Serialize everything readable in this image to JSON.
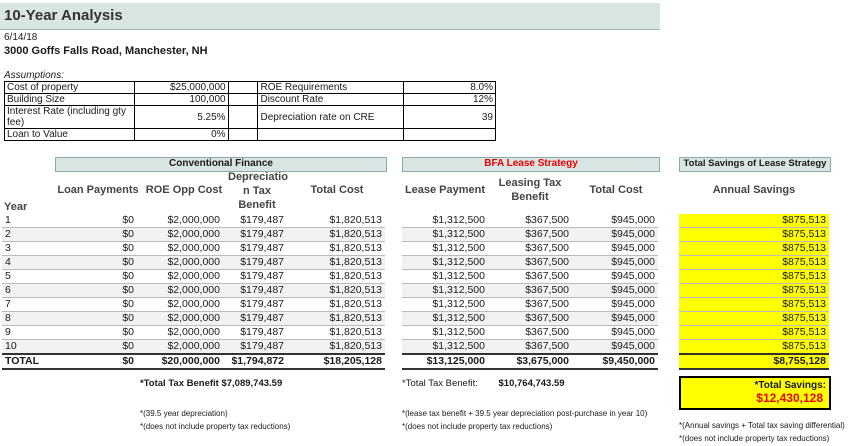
{
  "title": "10-Year Analysis",
  "date": "6/14/18",
  "address": "3000 Goffs Falls Road, Manchester, NH",
  "assumptions_label": "Assumptions:",
  "assumptions": [
    {
      "l1": "Cost of property",
      "v1": "$25,000,000",
      "l2": "ROE Requirements",
      "v2": "8.0%"
    },
    {
      "l1": "Building Size",
      "v1": "100,000",
      "l2": "Discount Rate",
      "v2": "12%"
    },
    {
      "l1": "Interest Rate (including gty fee)",
      "v1": "5.25%",
      "l2": "Depreciation rate on CRE",
      "v2": "39"
    },
    {
      "l1": "Loan to Value",
      "v1": "0%",
      "l2": "",
      "v2": ""
    }
  ],
  "conventional": {
    "header": "Conventional Finance",
    "year_label": "Year",
    "columns": [
      "Loan Payments",
      "ROE Opp Cost",
      "Depreciatio n Tax Benefit",
      "Total Cost"
    ],
    "rows": [
      {
        "year": "1",
        "loan": "$0",
        "roe": "$2,000,000",
        "dep": "$179,487",
        "total": "$1,820,513"
      },
      {
        "year": "2",
        "loan": "$0",
        "roe": "$2,000,000",
        "dep": "$179,487",
        "total": "$1,820,513"
      },
      {
        "year": "3",
        "loan": "$0",
        "roe": "$2,000,000",
        "dep": "$179,487",
        "total": "$1,820,513"
      },
      {
        "year": "4",
        "loan": "$0",
        "roe": "$2,000,000",
        "dep": "$179,487",
        "total": "$1,820,513"
      },
      {
        "year": "5",
        "loan": "$0",
        "roe": "$2,000,000",
        "dep": "$179,487",
        "total": "$1,820,513"
      },
      {
        "year": "6",
        "loan": "$0",
        "roe": "$2,000,000",
        "dep": "$179,487",
        "total": "$1,820,513"
      },
      {
        "year": "7",
        "loan": "$0",
        "roe": "$2,000,000",
        "dep": "$179,487",
        "total": "$1,820,513"
      },
      {
        "year": "8",
        "loan": "$0",
        "roe": "$2,000,000",
        "dep": "$179,487",
        "total": "$1,820,513"
      },
      {
        "year": "9",
        "loan": "$0",
        "roe": "$2,000,000",
        "dep": "$179,487",
        "total": "$1,820,513"
      },
      {
        "year": "10",
        "loan": "$0",
        "roe": "$2,000,000",
        "dep": "$179,487",
        "total": "$1,820,513"
      }
    ],
    "total": {
      "year": "TOTAL",
      "loan": "$0",
      "roe": "$20,000,000",
      "dep": "$1,794,872",
      "total": "$18,205,128"
    },
    "tax_benefit_label": "*Total Tax Benefit",
    "tax_benefit_value": "$7,089,743.59",
    "foot1": "*(39.5 year depreciation)",
    "foot2": "*(does not include property tax reductions)"
  },
  "bfa": {
    "header": "BFA Lease Strategy",
    "columns": [
      "Lease Payment",
      "Leasing Tax Benefit",
      "Total Cost"
    ],
    "rows": [
      {
        "lease": "$1,312,500",
        "tax": "$367,500",
        "total": "$945,000"
      },
      {
        "lease": "$1,312,500",
        "tax": "$367,500",
        "total": "$945,000"
      },
      {
        "lease": "$1,312,500",
        "tax": "$367,500",
        "total": "$945,000"
      },
      {
        "lease": "$1,312,500",
        "tax": "$367,500",
        "total": "$945,000"
      },
      {
        "lease": "$1,312,500",
        "tax": "$367,500",
        "total": "$945,000"
      },
      {
        "lease": "$1,312,500",
        "tax": "$367,500",
        "total": "$945,000"
      },
      {
        "lease": "$1,312,500",
        "tax": "$367,500",
        "total": "$945,000"
      },
      {
        "lease": "$1,312,500",
        "tax": "$367,500",
        "total": "$945,000"
      },
      {
        "lease": "$1,312,500",
        "tax": "$367,500",
        "total": "$945,000"
      },
      {
        "lease": "$1,312,500",
        "tax": "$367,500",
        "total": "$945,000"
      }
    ],
    "total": {
      "lease": "$13,125,000",
      "tax": "$3,675,000",
      "total": "$9,450,000"
    },
    "tax_benefit_label": "*Total Tax Benefit:",
    "tax_benefit_value": "$10,764,743.59",
    "foot1": "*(lease tax benefit + 39.5 year depreciation post-purchase in year 10)",
    "foot2": "*(does not include property tax reductions)"
  },
  "savings": {
    "header": "Total Savings of Lease Strategy",
    "column": "Annual  Savings",
    "rows": [
      "$875,513",
      "$875,513",
      "$875,513",
      "$875,513",
      "$875,513",
      "$875,513",
      "$875,513",
      "$875,513",
      "$875,513",
      "$875,513"
    ],
    "total": "$8,755,128",
    "total_label": "*Total Savings:",
    "total_value": "$12,430,128",
    "foot1": "*(Annual savings + Total tax saving differential)",
    "foot2": "*(does not include property tax reductions)"
  },
  "colors": {
    "header_bg": "#d9e5e2",
    "highlight": "#ffff00",
    "accent_red": "#e00000"
  }
}
